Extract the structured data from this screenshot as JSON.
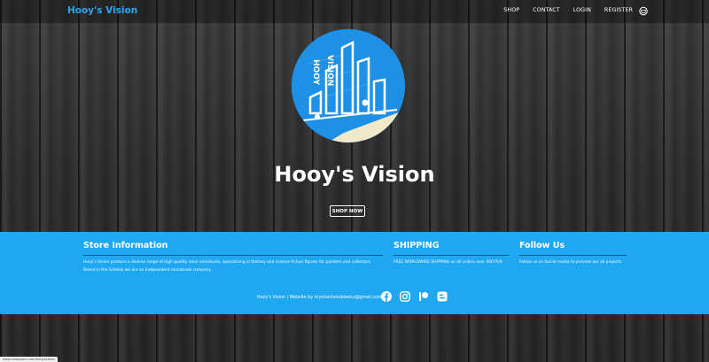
{
  "navbar": {
    "brand": "Hooy's Vision",
    "links": [
      {
        "label": "SHOP"
      },
      {
        "label": "CONTACT"
      },
      {
        "label": "LOGIN"
      },
      {
        "label": "REGISTER"
      }
    ],
    "cart_icon": "basket-icon"
  },
  "hero": {
    "title": "Hooy's Vision",
    "logo_text": "HOOY VISION",
    "shop_button": "SHOP NOW"
  },
  "footer": {
    "store": {
      "heading": "Store Information",
      "text1": "Hooy's Vision produce a diverse range of high quality resin miniatures, specialising in fantasy and science fiction figures for painters and collectors.",
      "text2": "Based in the Gdańsk we are an independent miniatures company"
    },
    "shipping": {
      "heading": "SHIPPING",
      "text": "FREE WORLDWIDE SHIPPING on all orders over 400 PLN"
    },
    "follow": {
      "heading": "Follow Us",
      "text": "Follow us on Social media to preview our all projects"
    },
    "credit": "Hooy's Vision | Website by krystianholubowicz@gmail.com",
    "socials": [
      "facebook-icon",
      "instagram-icon",
      "patreon-icon",
      "blogger-icon"
    ]
  },
  "statusbar": {
    "url": "www.instagram.com/hooysvision"
  },
  "colors": {
    "accent": "#1fa7f2",
    "brand": "#2aa6f2",
    "rule": "#0a5d92"
  }
}
